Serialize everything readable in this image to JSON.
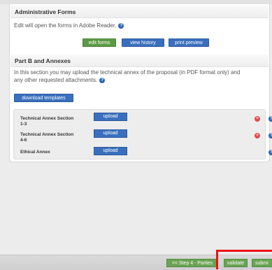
{
  "admin": {
    "title": "Administrative Forms",
    "description": "Edit will open the forms in Adobe Reader.",
    "buttons": {
      "edit": "edit forms",
      "history": "view history",
      "print": "print preview"
    }
  },
  "partb": {
    "title": "Part B and Annexes",
    "description_line1": "In this section you may upload the technical annex of the proposal (in PDF format only) and",
    "description_line2": "any other requested attachments.",
    "download_label": "download templates",
    "attachments": [
      {
        "line1": "Technical Annex Section",
        "line2": "1-3",
        "upload": "upload",
        "removable": true
      },
      {
        "line1": "Technical Annex Section",
        "line2": "4-6",
        "upload": "upload",
        "removable": true
      },
      {
        "line1": "Ethical Annex",
        "line2": "",
        "upload": "upload",
        "removable": false
      }
    ]
  },
  "icons": {
    "info": "info-icon",
    "delete": "remove-icon",
    "help": "help-icon"
  },
  "footer": {
    "back": "<< Step 4 - Parties",
    "validate": "validate",
    "submit": "submi"
  },
  "colors": {
    "green": "#5c9a45",
    "blue": "#3a6fbd",
    "highlight": "#ee1111"
  }
}
